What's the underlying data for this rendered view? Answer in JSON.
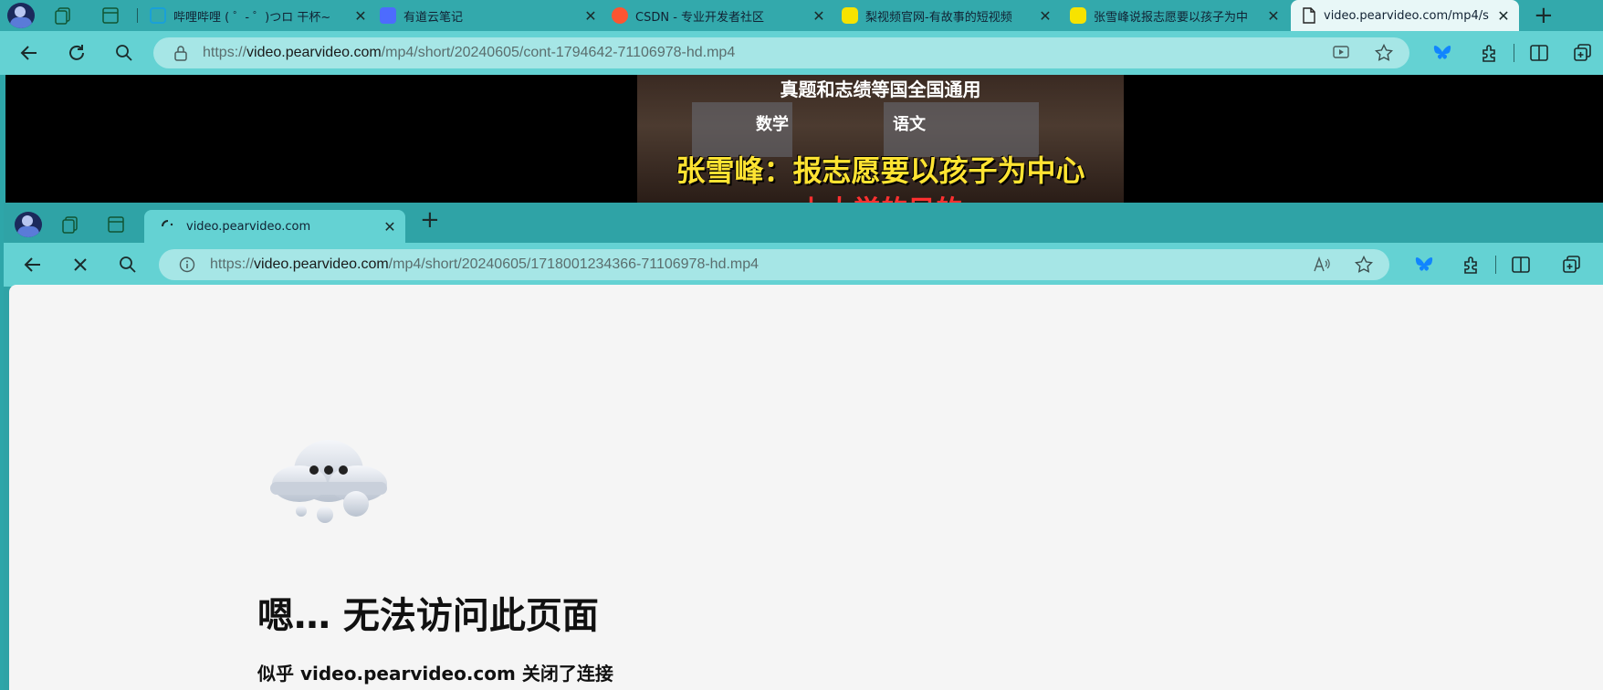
{
  "back_window": {
    "tabs": [
      {
        "title": "哔哩哔哩 ( ゜- ゜)つロ 干杯~",
        "favicon": "tv-icon",
        "color": "#1aa0d8"
      },
      {
        "title": "有道云笔记",
        "favicon": "pen-icon",
        "color": "#4d6bfe"
      },
      {
        "title": "CSDN - 专业开发者社区",
        "favicon": "csdn-icon",
        "color": "#fc5531"
      },
      {
        "title": "梨视频官网-有故事的短视频",
        "favicon": "pear-icon",
        "color": "#f7e300"
      },
      {
        "title": "张雪峰说报志愿要以孩子为中",
        "favicon": "pear-icon",
        "color": "#f7e300"
      },
      {
        "title": "video.pearvideo.com/mp4/s",
        "favicon": "page-icon",
        "active": true
      }
    ],
    "address": {
      "scheme": "https://",
      "host": "video.pearvideo.com",
      "path": "/mp4/short/20240605/cont-1794642-71106978-hd.mp4"
    },
    "video": {
      "caption_top": "真题和志绩等国全国通用",
      "shelf_label_1": "数学",
      "shelf_label_2": "语文",
      "caption_main": "张雪峰：报志愿要以孩子为中心",
      "caption_bottom": "上大学的目的"
    }
  },
  "front_window": {
    "tab": {
      "title": "video.pearvideo.com",
      "loading": true
    },
    "address": {
      "scheme": "https://",
      "host": "video.pearvideo.com",
      "path": "/mp4/short/20240605/1718001234366-71106978-hd.mp4"
    },
    "error": {
      "title": "嗯… 无法访问此页面",
      "subtitle": "似乎 video.pearvideo.com 关闭了连接"
    }
  },
  "colors": {
    "accent": "#33a9ac",
    "toolbar": "#64d2d3",
    "address_bg": "#a6e6e6",
    "bluesky": "#1185fe"
  }
}
